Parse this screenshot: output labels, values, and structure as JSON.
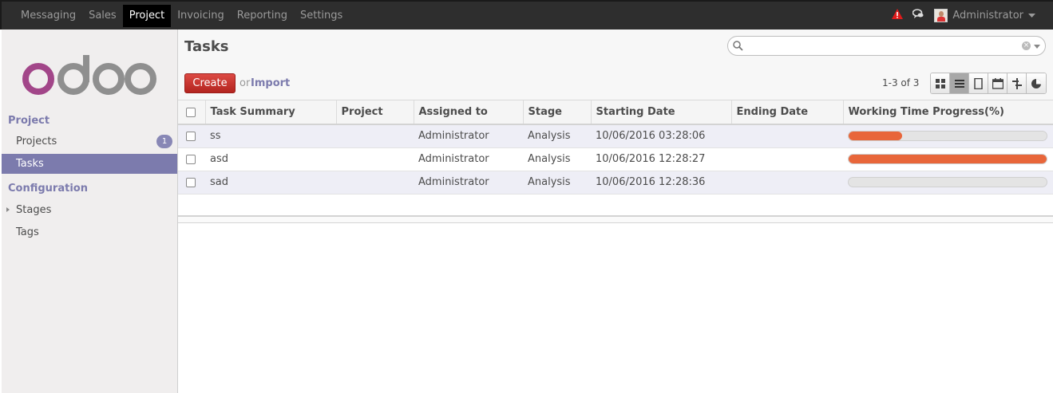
{
  "topmenu": {
    "items": [
      "Messaging",
      "Sales",
      "Project",
      "Invoicing",
      "Reporting",
      "Settings"
    ],
    "active": "Project"
  },
  "user": {
    "name": "Administrator"
  },
  "sidebar": {
    "section1": "Project",
    "projects_label": "Projects",
    "projects_badge": "1",
    "tasks_label": "Tasks",
    "section2": "Configuration",
    "stages_label": "Stages",
    "tags_label": "Tags"
  },
  "control_panel": {
    "title": "Tasks",
    "create_label": "Create",
    "or_label": "or",
    "import_label": "Import",
    "pager": "1-3 of 3",
    "search_value": ""
  },
  "table": {
    "columns": [
      "Task Summary",
      "Project",
      "Assigned to",
      "Stage",
      "Starting Date",
      "Ending Date",
      "Working Time Progress(%)"
    ],
    "rows": [
      {
        "summary": "ss",
        "project": "",
        "assigned": "Administrator",
        "stage": "Analysis",
        "start": "10/06/2016 03:28:06",
        "end": "",
        "progress": 0.27
      },
      {
        "summary": "asd",
        "project": "",
        "assigned": "Administrator",
        "stage": "Analysis",
        "start": "10/06/2016 12:28:27",
        "end": "",
        "progress": 1.0
      },
      {
        "summary": "sad",
        "project": "",
        "assigned": "Administrator",
        "stage": "Analysis",
        "start": "10/06/2016 12:28:36",
        "end": "",
        "progress": 0.0
      }
    ]
  },
  "colors": {
    "accent": "#7c7bad",
    "create": "#c9302c",
    "progress": "#e8663a",
    "logo": "#a24689"
  }
}
